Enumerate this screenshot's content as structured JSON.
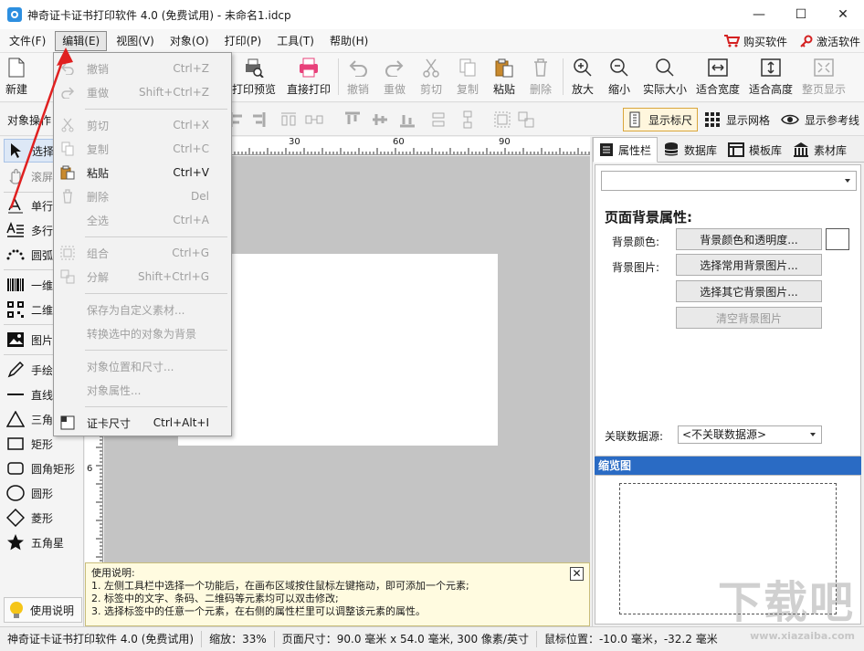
{
  "window": {
    "title": "神奇证卡证书打印软件 4.0 (免费试用) - 未命名1.idcp",
    "minimize": "—",
    "maximize": "☐",
    "close": "✕"
  },
  "menubar": {
    "items": [
      "文件(F)",
      "编辑(E)",
      "视图(V)",
      "对象(O)",
      "打印(P)",
      "工具(T)",
      "帮助(H)"
    ],
    "buy": "购买软件",
    "activate": "激活软件"
  },
  "toolbar": {
    "new": "新建",
    "print_preview": "打印预览",
    "direct_print": "直接打印",
    "undo": "撤销",
    "redo": "重做",
    "cut": "剪切",
    "copy": "复制",
    "paste": "粘贴",
    "delete": "删除",
    "zoom_in": "放大",
    "zoom_out": "缩小",
    "actual_size": "实际大小",
    "fit_width": "适合宽度",
    "fit_height": "适合高度",
    "fit_page": "整页显示"
  },
  "toolbar2": {
    "label": "对象操作",
    "show_ruler": "显示标尺",
    "show_grid": "显示网格",
    "show_guides": "显示参考线"
  },
  "left_tools": {
    "select": "选择",
    "scroll": "滚屏",
    "single_text": "单行",
    "multi_text": "多行",
    "arc_text": "圆弧",
    "barcode_1d": "一维",
    "barcode_2d": "二维",
    "image": "图片",
    "freehand": "手绘",
    "line": "直线",
    "triangle": "三角",
    "rect": "矩形",
    "round_rect": "圆角矩形",
    "circle": "圆形",
    "diamond": "菱形",
    "star": "五角星",
    "help": "使用说明"
  },
  "ruler": {
    "top_labels": [
      "30",
      "60",
      "90"
    ],
    "left_labels": [
      "6"
    ]
  },
  "notice": {
    "title": "使用说明:",
    "line1": "1. 左侧工具栏中选择一个功能后，在画布区域按住鼠标左键拖动，即可添加一个元素;",
    "line2": "2. 标签中的文字、条码、二维码等元素均可以双击修改;",
    "line3": "3. 选择标签中的任意一个元素，在右侧的属性栏里可以调整该元素的属性。",
    "close": "✕"
  },
  "right_panel": {
    "tabs": [
      "属性栏",
      "数据库",
      "模板库",
      "素材库"
    ],
    "heading": "页面背景属性:",
    "bg_color_label": "背景颜色:",
    "bg_color_btn": "背景颜色和透明度...",
    "bg_image_label": "背景图片:",
    "bg_common_btn": "选择常用背景图片...",
    "bg_other_btn": "选择其它背景图片...",
    "bg_clear_btn": "清空背景图片",
    "datasource_label": "关联数据源:",
    "datasource_value": "<不关联数据源>",
    "thumbnail_title": "缩览图"
  },
  "edit_menu": {
    "items": [
      {
        "label": "撤销",
        "shortcut": "Ctrl+Z",
        "enabled": false
      },
      {
        "label": "重做",
        "shortcut": "Shift+Ctrl+Z",
        "enabled": false
      },
      {
        "label": "剪切",
        "shortcut": "Ctrl+X",
        "enabled": false
      },
      {
        "label": "复制",
        "shortcut": "Ctrl+C",
        "enabled": false
      },
      {
        "label": "粘贴",
        "shortcut": "Ctrl+V",
        "enabled": true
      },
      {
        "label": "删除",
        "shortcut": "Del",
        "enabled": false
      },
      {
        "label": "全选",
        "shortcut": "Ctrl+A",
        "enabled": false
      },
      {
        "label": "组合",
        "shortcut": "Ctrl+G",
        "enabled": false
      },
      {
        "label": "分解",
        "shortcut": "Shift+Ctrl+G",
        "enabled": false
      },
      {
        "label": "保存为自定义素材...",
        "shortcut": "",
        "enabled": false
      },
      {
        "label": "转换选中的对象为背景",
        "shortcut": "",
        "enabled": false
      },
      {
        "label": "对象位置和尺寸...",
        "shortcut": "",
        "enabled": false
      },
      {
        "label": "对象属性...",
        "shortcut": "",
        "enabled": false
      },
      {
        "label": "证卡尺寸",
        "shortcut": "Ctrl+Alt+I",
        "enabled": true
      }
    ]
  },
  "statusbar": {
    "app": "神奇证卡证书打印软件 4.0 (免费试用)",
    "zoom": "缩放：33%",
    "page_size": "页面尺寸：90.0 毫米 x 54.0 毫米, 300 像素/英寸",
    "mouse_pos": "鼠标位置：-10.0 毫米，-32.2 毫米"
  },
  "watermark": {
    "text": "下载吧",
    "sub": "www.xiazaiba.com"
  },
  "colors": {
    "accent": "#2a6bc4",
    "annotation_arrow": "#e02020",
    "canvas": "#c4c4c4"
  }
}
